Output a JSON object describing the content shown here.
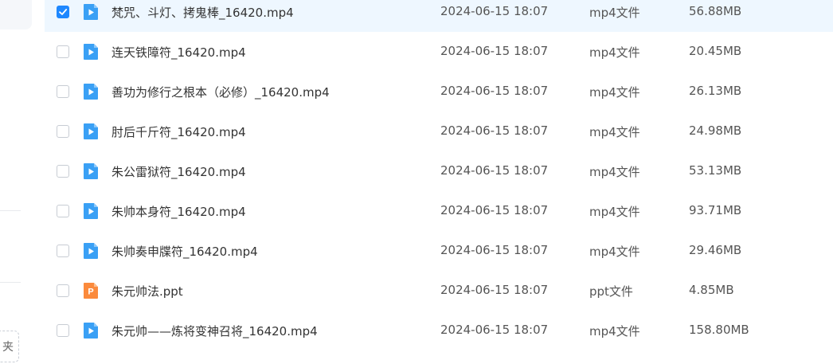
{
  "sidebar": {
    "folder_button_label": "夹"
  },
  "files": [
    {
      "name": "梵咒、斗灯、拷鬼棒_16420.mp4",
      "date": "2024-06-15 18:07",
      "type": "mp4文件",
      "size": "56.88MB",
      "icon": "video-file-icon",
      "selected": true
    },
    {
      "name": "连天铁障符_16420.mp4",
      "date": "2024-06-15 18:07",
      "type": "mp4文件",
      "size": "20.45MB",
      "icon": "video-file-icon",
      "selected": false
    },
    {
      "name": "善功为修行之根本（必修）_16420.mp4",
      "date": "2024-06-15 18:07",
      "type": "mp4文件",
      "size": "26.13MB",
      "icon": "video-file-icon",
      "selected": false
    },
    {
      "name": "肘后千斤符_16420.mp4",
      "date": "2024-06-15 18:07",
      "type": "mp4文件",
      "size": "24.98MB",
      "icon": "video-file-icon",
      "selected": false
    },
    {
      "name": "朱公雷狱符_16420.mp4",
      "date": "2024-06-15 18:07",
      "type": "mp4文件",
      "size": "53.13MB",
      "icon": "video-file-icon",
      "selected": false
    },
    {
      "name": "朱帅本身符_16420.mp4",
      "date": "2024-06-15 18:07",
      "type": "mp4文件",
      "size": "93.71MB",
      "icon": "video-file-icon",
      "selected": false
    },
    {
      "name": "朱帅奏申牒符_16420.mp4",
      "date": "2024-06-15 18:07",
      "type": "mp4文件",
      "size": "29.46MB",
      "icon": "video-file-icon",
      "selected": false
    },
    {
      "name": "朱元帅法.ppt",
      "date": "2024-06-15 18:07",
      "type": "ppt文件",
      "size": "4.85MB",
      "icon": "ppt-file-icon",
      "selected": false
    },
    {
      "name": "朱元帅——炼将变神召将_16420.mp4",
      "date": "2024-06-15 18:07",
      "type": "mp4文件",
      "size": "158.80MB",
      "icon": "video-file-icon",
      "selected": false
    }
  ],
  "colors": {
    "accent": "#1e88ff",
    "video_icon": "#3aa0f5",
    "ppt_icon": "#fb8a3c",
    "selected_row_bg": "#eef7ff"
  }
}
